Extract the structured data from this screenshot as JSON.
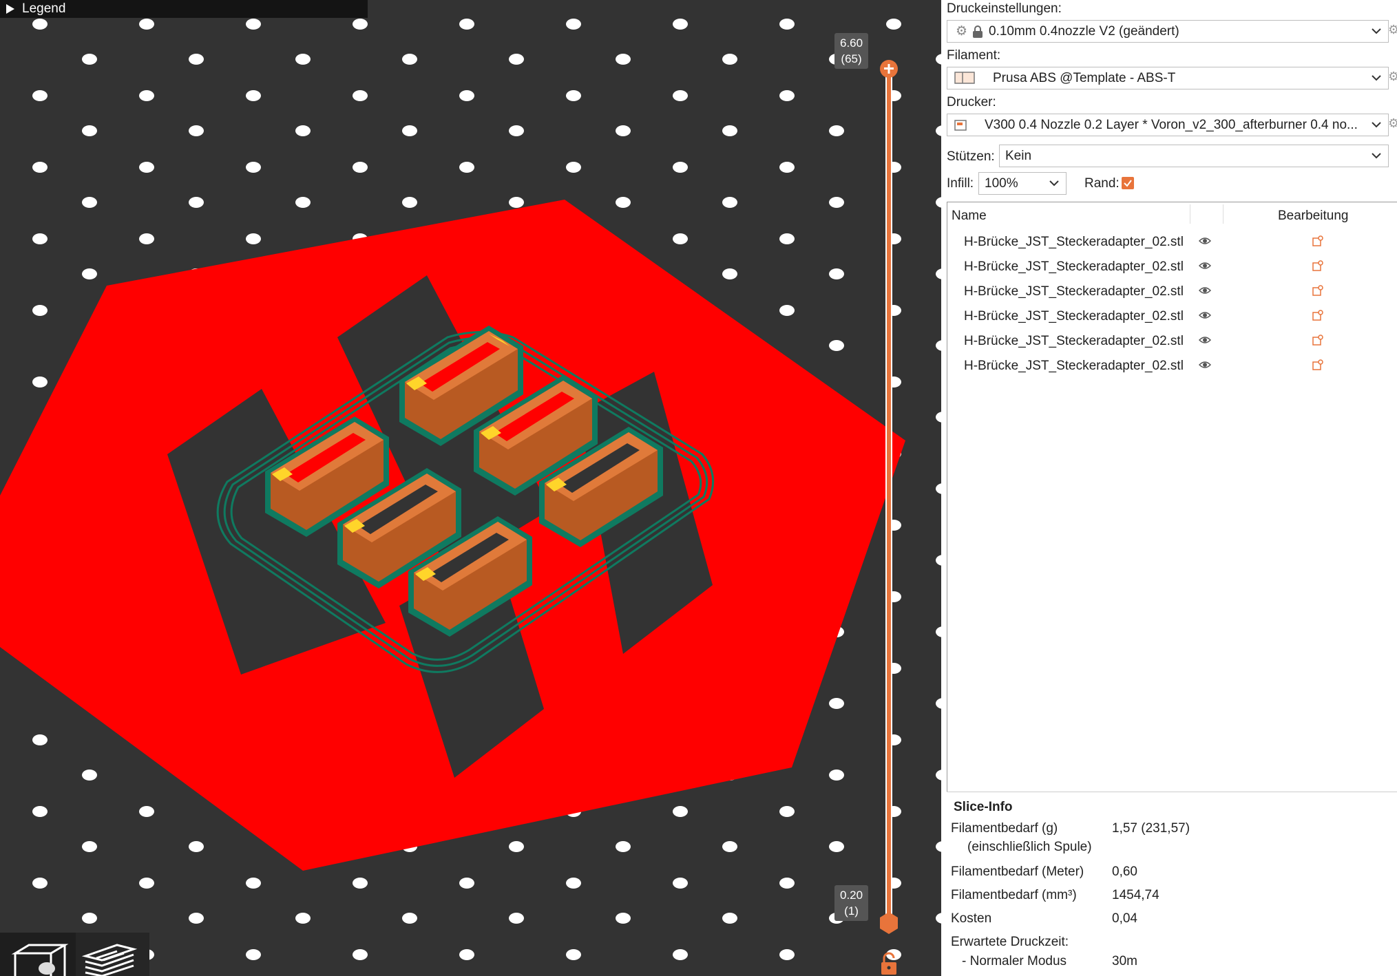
{
  "viewport": {
    "legend_label": "Legend",
    "slider_top": {
      "value": "6.60",
      "layer": "(65)"
    },
    "slider_bottom": {
      "value": "0.20",
      "layer": "(1)"
    },
    "colors": {
      "background": "#333333",
      "bed_dots": "#ffffff",
      "bed_plate": "#ff0000",
      "object": "#c2632a",
      "brim": "#0f7a60",
      "slider": "#e8743b"
    },
    "toolbar": {
      "view_3d_icon": "cube-icon",
      "preview_icon": "layers-icon"
    },
    "lock_icon": "lock-open-icon"
  },
  "panel": {
    "print_settings_label": "Druckeinstellungen:",
    "print_settings_value": "0.10mm 0.4nozzle V2 (geändert)",
    "filament_label": "Filament:",
    "filament_value": "Prusa ABS @Template - ABS-T",
    "printer_label": "Drucker:",
    "printer_value": "V300 0.4 Nozzle 0.2 Layer * Voron_v2_300_afterburner 0.4 no...",
    "supports_label": "Stützen:",
    "supports_value": "Kein",
    "infill_label": "Infill:",
    "infill_value": "100%",
    "brim_label": "Rand:",
    "brim_checked": true,
    "objects": {
      "col_name": "Name",
      "col_edit": "Bearbeitung",
      "items": [
        {
          "name": "H-Brücke_JST_Steckeradapter_02.stl"
        },
        {
          "name": "H-Brücke_JST_Steckeradapter_02.stl"
        },
        {
          "name": "H-Brücke_JST_Steckeradapter_02.stl"
        },
        {
          "name": "H-Brücke_JST_Steckeradapter_02.stl"
        },
        {
          "name": "H-Brücke_JST_Steckeradapter_02.stl"
        },
        {
          "name": "H-Brücke_JST_Steckeradapter_02.stl"
        }
      ]
    },
    "slice_info": {
      "title": "Slice-Info",
      "filament_g_label": "Filamentbedarf (g)",
      "filament_g_sub": "(einschließlich Spule)",
      "filament_g_value": "1,57 (231,57)",
      "filament_m_label": "Filamentbedarf (Meter)",
      "filament_m_value": "0,60",
      "filament_mm3_label": "Filamentbedarf (mm³)",
      "filament_mm3_value": "1454,74",
      "cost_label": "Kosten",
      "cost_value": "0,04",
      "time_label": "Erwartete Druckzeit:",
      "mode_label": "- Normaler Modus",
      "mode_value": "30m"
    },
    "accent_color": "#e8743b"
  }
}
